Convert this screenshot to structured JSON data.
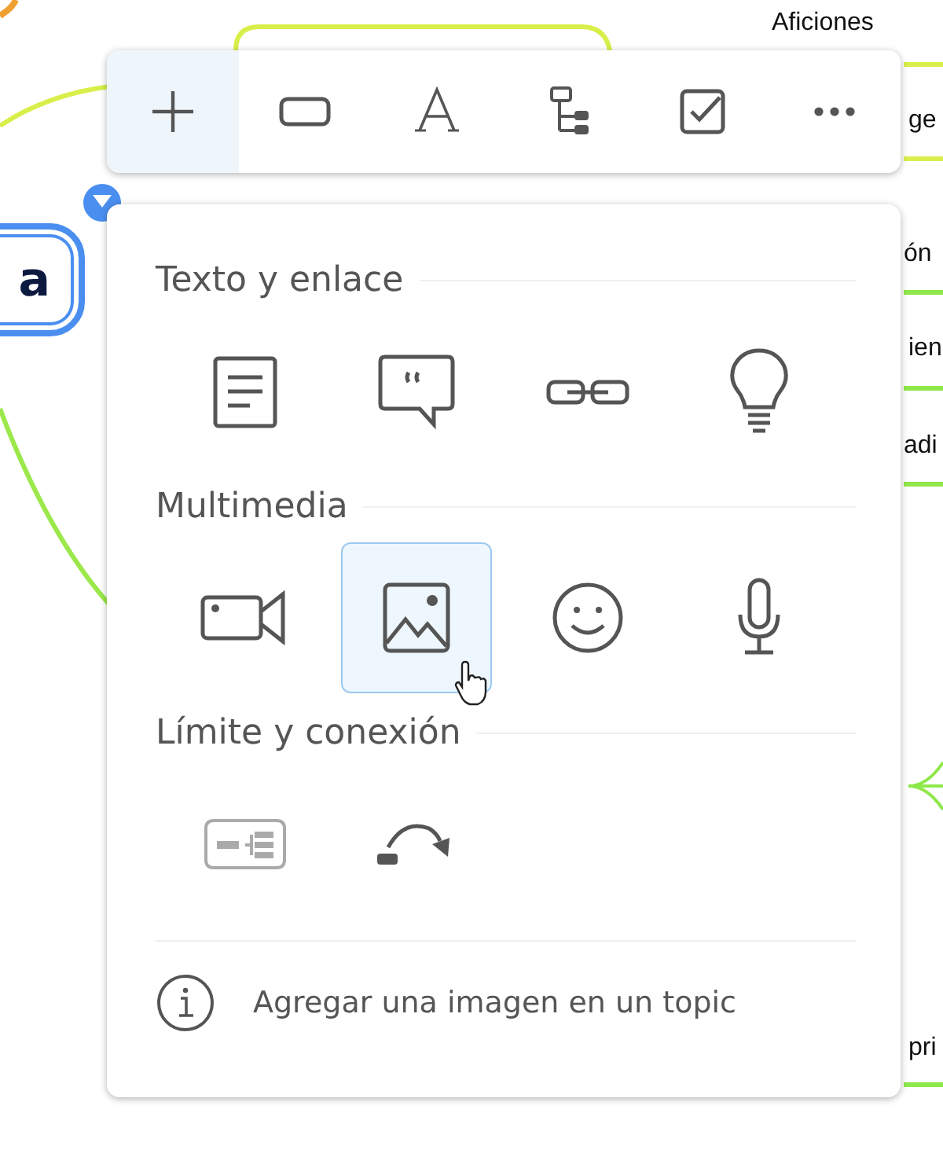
{
  "canvas": {
    "node_labels": [
      {
        "text": "Aficiones"
      },
      {
        "text": "ge"
      },
      {
        "text": "ón"
      },
      {
        "text": "ien"
      },
      {
        "text": "adi"
      },
      {
        "text": "pri"
      }
    ],
    "selected_topic": {
      "text": "a"
    }
  },
  "toolbar": {
    "buttons": [
      {
        "kind": "add",
        "selected": true
      },
      {
        "kind": "topic",
        "selected": false
      },
      {
        "kind": "text",
        "selected": false
      },
      {
        "kind": "structure",
        "selected": false
      },
      {
        "kind": "task",
        "selected": false
      },
      {
        "kind": "more",
        "selected": false
      }
    ]
  },
  "panel": {
    "sections": [
      {
        "title": "Texto y enlace",
        "items": [
          {
            "kind": "note",
            "selected": false,
            "disabled": false
          },
          {
            "kind": "comment",
            "selected": false,
            "disabled": false
          },
          {
            "kind": "link",
            "selected": false,
            "disabled": false
          },
          {
            "kind": "idea",
            "selected": false,
            "disabled": false
          }
        ]
      },
      {
        "title": "Multimedia",
        "items": [
          {
            "kind": "video",
            "selected": false,
            "disabled": false
          },
          {
            "kind": "image",
            "selected": true,
            "disabled": false
          },
          {
            "kind": "emoji",
            "selected": false,
            "disabled": false
          },
          {
            "kind": "audio",
            "selected": false,
            "disabled": false
          }
        ]
      },
      {
        "title": "Límite y conexión",
        "items": [
          {
            "kind": "boundary",
            "selected": false,
            "disabled": true
          },
          {
            "kind": "relationship",
            "selected": false,
            "disabled": false
          }
        ]
      }
    ],
    "hint": {
      "text": "Agregar una imagen en un topic"
    }
  }
}
